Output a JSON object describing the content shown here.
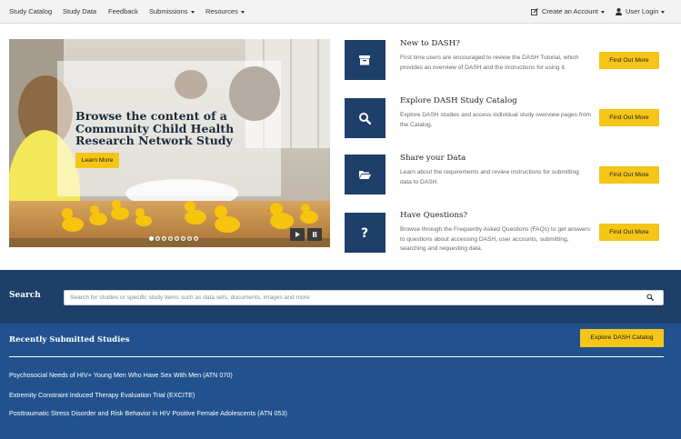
{
  "nav": {
    "left": [
      {
        "label": "Study Catalog"
      },
      {
        "label": "Study Data"
      },
      {
        "label": "Feedback"
      },
      {
        "label": "Submissions",
        "dropdown": true
      },
      {
        "label": "Resources",
        "dropdown": true
      }
    ],
    "create_account": "Create an Account",
    "user_login": "User Login"
  },
  "carousel": {
    "caption": "Browse the content of a Community Child Health Research Network Study",
    "button": "Learn More",
    "slide_count": 8,
    "active_slide": 1
  },
  "features": [
    {
      "icon": "archive-box-icon",
      "title": "New to DASH?",
      "description": "First time users are encouraged to review the DASH Tutorial, which provides an overview of DASH and the instructions for using it.",
      "button": "Find Out More"
    },
    {
      "icon": "search-icon",
      "title": "Explore DASH Study Catalog",
      "description": "Explore DASH studies and access individual study overview pages from the Catalog.",
      "button": "Find Out More"
    },
    {
      "icon": "folder-open-icon",
      "title": "Share your Data",
      "description": "Learn about the requirements and review instructions for submitting data to DASH.",
      "button": "Find Out More"
    },
    {
      "icon": "question-icon",
      "title": "Have Questions?",
      "description": "Browse through the Frequently Asked Questions (FAQs) to get answers to questions about accessing DASH, user accounts, submitting, searching and requesting data.",
      "button": "Find Out More"
    }
  ],
  "search": {
    "label": "Search",
    "placeholder": "Search for studies or specific study items such as data sets, documents, images and more"
  },
  "recent": {
    "title": "Recently Submitted Studies",
    "button": "Explore DASH Catalog",
    "studies": [
      "Psychosocial Needs of HIV+ Young Men Who Have Sex With Men (ATN 070)",
      "Extremity Constraint Induced Therapy Evaluation Trial (EXCITE)",
      "Posttraumatic Stress Disorder and Risk Behavior in HIV Positive Female Adolescents (ATN 053)"
    ]
  },
  "colors": {
    "navy": "#1d3f69",
    "blue": "#22528e",
    "accent_yellow": "#f5c518",
    "nav_bg": "#f3f3f3"
  }
}
